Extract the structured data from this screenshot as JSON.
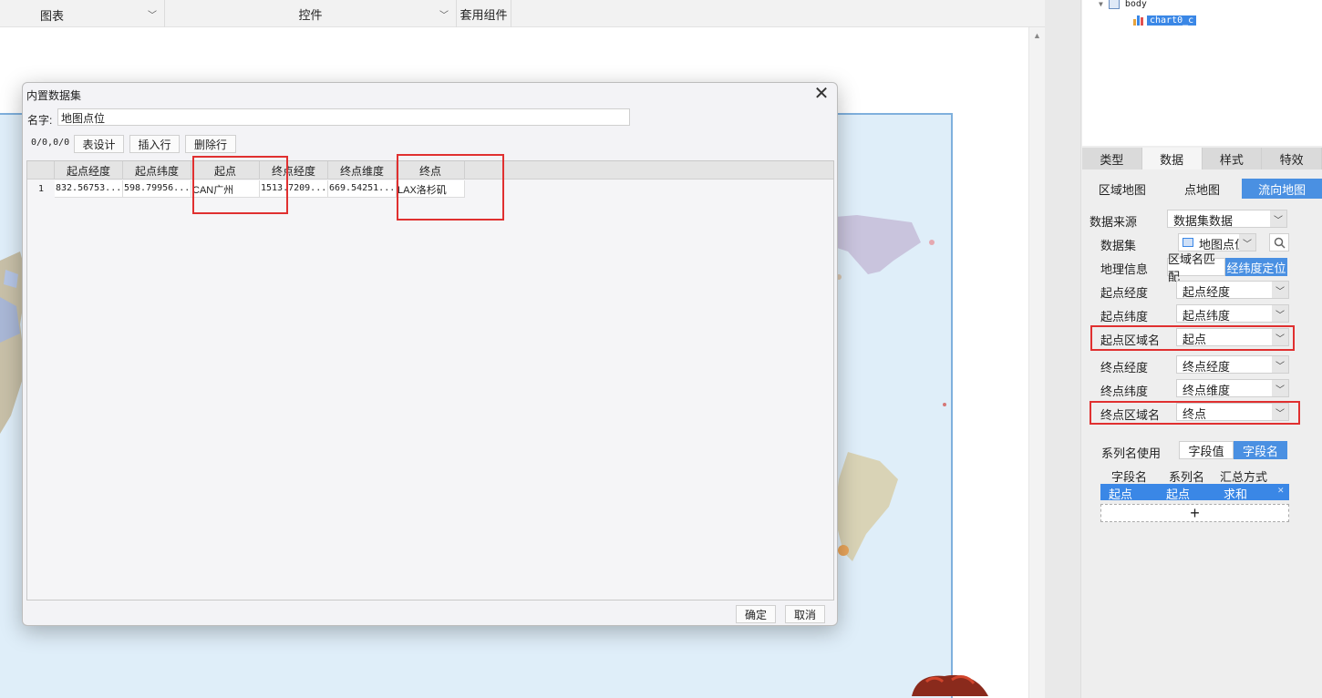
{
  "toolbar": {
    "chart_label": "图表",
    "widget_label": "控件",
    "component_label": "套用组件"
  },
  "tree": {
    "body_label": "body",
    "chart_label": "chart0_c"
  },
  "panel": {
    "tabs": [
      "类型",
      "数据",
      "样式",
      "特效"
    ],
    "active_tab": "数据",
    "subtabs": [
      "区域地图",
      "点地图",
      "流向地图"
    ],
    "active_subtab": "流向地图",
    "data_source_label": "数据来源",
    "data_source_value": "数据集数据",
    "dataset_label": "数据集",
    "dataset_value": "地图点位",
    "geo_label": "地理信息",
    "geo_options": [
      "区域名匹配",
      "经纬度定位"
    ],
    "geo_active": "经纬度定位",
    "start_lng_label": "起点经度",
    "start_lng_value": "起点经度",
    "start_lat_label": "起点纬度",
    "start_lat_value": "起点纬度",
    "start_region_label": "起点区域名",
    "start_region_value": "起点",
    "end_lng_label": "终点经度",
    "end_lng_value": "终点经度",
    "end_lat_label": "终点纬度",
    "end_lat_value": "终点维度",
    "end_region_label": "终点区域名",
    "end_region_value": "终点",
    "series_name_label": "系列名使用",
    "series_options": [
      "字段值",
      "字段名"
    ],
    "series_active": "字段名",
    "field_headers": [
      "字段名",
      "系列名",
      "汇总方式"
    ],
    "field_row": [
      "起点",
      "起点",
      "求和"
    ],
    "add_symbol": "+"
  },
  "dialog": {
    "title": "内置数据集",
    "name_label": "名字:",
    "name_value": "地图点位",
    "counter": "0/0,0/0",
    "btn_table_design": "表设计",
    "btn_insert_row": "插入行",
    "btn_delete_row": "删除行",
    "columns": [
      "起点经度",
      "起点纬度",
      "起点",
      "终点经度",
      "终点维度",
      "终点"
    ],
    "rows": [
      {
        "num": "1",
        "cells": [
          "832.56753...",
          "598.79956...",
          "CAN广州",
          "1513.7209...",
          "669.54251...",
          "LAX洛杉矶"
        ]
      }
    ],
    "ok_label": "确定",
    "cancel_label": "取消",
    "close_symbol": "✕"
  },
  "colors": {
    "accent": "#3a87e6",
    "highlight_red": "#e03030",
    "map_ocean": "#dfeef9"
  }
}
